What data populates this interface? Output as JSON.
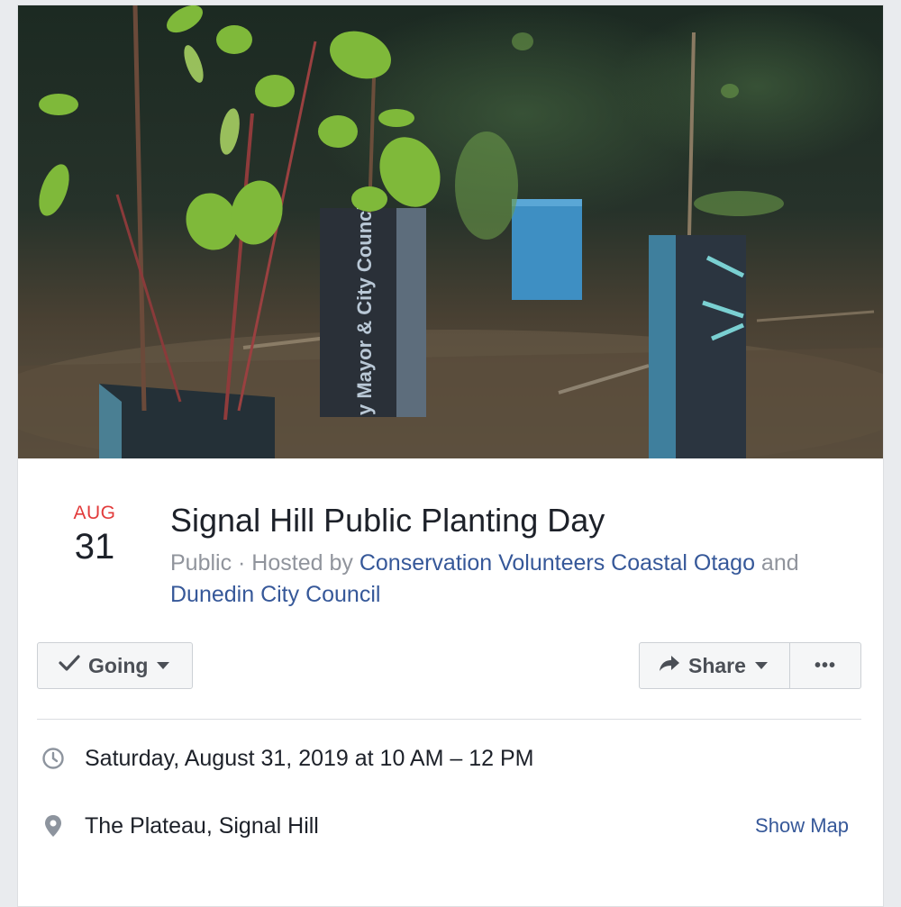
{
  "event": {
    "date_month": "AUG",
    "date_day": "31",
    "title": "Signal Hill Public Planting Day",
    "privacy": "Public",
    "separator": " · Hosted by ",
    "host_1": "Conservation Volunteers Coastal Otago",
    "conjunction": " and ",
    "host_2": "Dunedin City Council"
  },
  "actions": {
    "going_label": "Going",
    "share_label": "Share",
    "more_label": "•••"
  },
  "details": {
    "datetime": "Saturday, August 31, 2019 at 10 AM – 12 PM",
    "location": "The Plateau, Signal Hill",
    "show_map_label": "Show Map"
  },
  "cover": {
    "tree_guard_text": "y Mayor & City Council"
  },
  "colors": {
    "accent_red": "#e23b3b",
    "link_blue": "#365899",
    "text_dark": "#1d2129",
    "text_muted": "#90949c"
  },
  "icons": {
    "going": "check-icon",
    "share": "share-arrow-icon",
    "time": "clock-icon",
    "location": "map-pin-icon"
  }
}
